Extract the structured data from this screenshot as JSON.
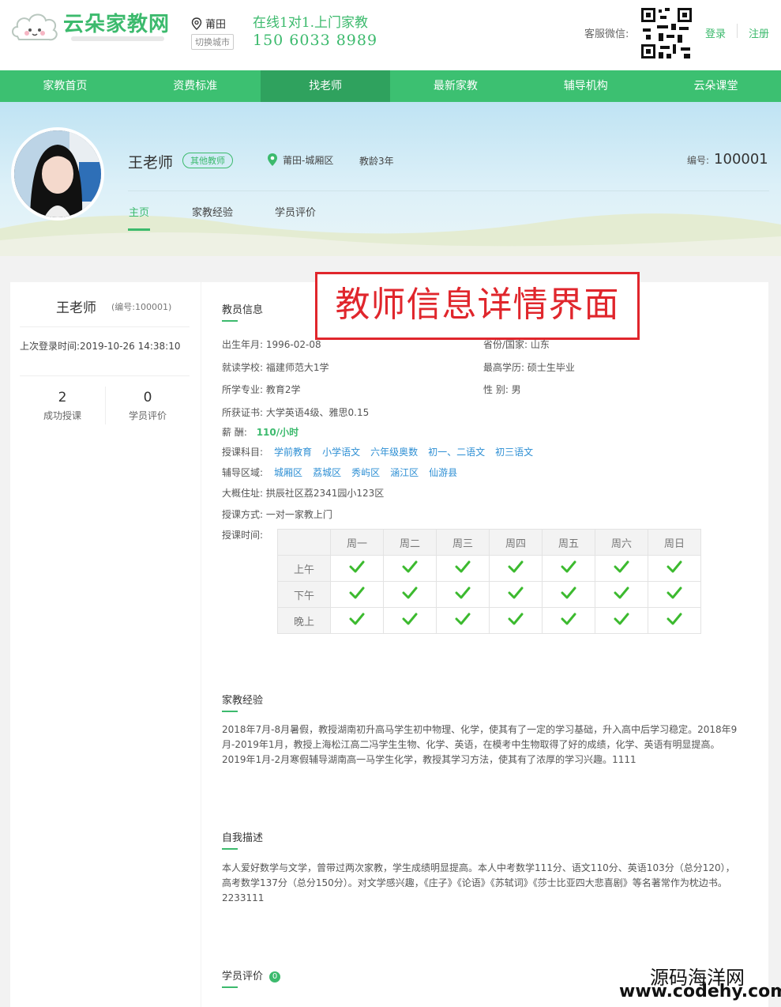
{
  "header": {
    "logo_text": "云朵家教网",
    "city": "莆田",
    "city_switch": "切换城市",
    "slogan": "在线1对1.上门家教",
    "phone": "150 6033 8989",
    "service_label": "客服微信:",
    "login": "登录",
    "register": "注册"
  },
  "nav": [
    "家教首页",
    "资费标准",
    "找老师",
    "最新家教",
    "辅导机构",
    "云朵课堂"
  ],
  "teacher": {
    "name": "王老师",
    "tag": "其他教师",
    "location": "莆田-城厢区",
    "teaching_age": "教龄3年",
    "id_label": "编号:",
    "id_value": "100001",
    "tabs": [
      "主页",
      "家教经验",
      "学员评价"
    ]
  },
  "sidebar": {
    "name": "王老师",
    "num": "(编号:100001)",
    "last_login": "上次登录时间:2019-10-26 14:38:10",
    "stats": [
      {
        "num": "2",
        "label": "成功授课"
      },
      {
        "num": "0",
        "label": "学员评价"
      }
    ]
  },
  "info": {
    "title": "教员信息",
    "birth": "出生年月:  1996-02-08",
    "province": "省份/国家:  山东",
    "school": "就读学校:  福建师范大1学",
    "degree": "最高学历:  硕士生毕业",
    "major": "所学专业:  教育2学",
    "gender": "性      别:  男",
    "cert": "所获证书:  大学英语4级、雅思0.15",
    "salary_label": "薪      酬:",
    "salary_value": "110/小时",
    "subjects_label": "授课科目:",
    "subjects": [
      "学前教育",
      "小学语文",
      "六年级奥数",
      "初一、二语文",
      "初三语文"
    ],
    "areas_label": "辅导区域:",
    "areas": [
      "城厢区",
      "荔城区",
      "秀屿区",
      "涵江区",
      "仙游县"
    ],
    "address": "大概住址:    拱辰社区荔2341园小123区",
    "method": "授课方式:    一对一家教上门",
    "time_label": "授课时间:"
  },
  "schedule": {
    "days": [
      "周一",
      "周二",
      "周三",
      "周四",
      "周五",
      "周六",
      "周日"
    ],
    "rows": [
      "上午",
      "下午",
      "晚上"
    ],
    "check_color": "#3cba2f"
  },
  "experience": {
    "title": "家教经验",
    "text": "2018年7月-8月暑假，教授湖南初升高马学生初中物理、化学，使其有了一定的学习基础，升入高中后学习稳定。2018年9月-2019年1月，教授上海松江高二冯学生生物、化学、英语，在模考中生物取得了好的成绩，化学、英语有明显提高。2019年1月-2月寒假辅导湖南高一马学生化学，教授其学习方法，使其有了浓厚的学习兴趣。1111"
  },
  "self_desc": {
    "title": "自我描述",
    "text": "本人爱好数学与文学，曾带过两次家教，学生成绩明显提高。本人中考数学111分、语文110分、英语103分（总分120），高考数学137分（总分150分）。对文学感兴趣，《庄子》《论语》《苏轼词》《莎士比亚四大悲喜剧》等名著常作为枕边书。2233111"
  },
  "reviews": {
    "title": "学员评价",
    "count": "0"
  },
  "annotation": "教师信息详情界面",
  "watermark": {
    "line1": "源码海洋网",
    "line2": "www.codehy.com"
  },
  "colors": {
    "brand_green": "#3cc071",
    "nav_active": "#2fa25e",
    "link_blue": "#2e8fd4",
    "annotation_red": "#e0262c"
  }
}
